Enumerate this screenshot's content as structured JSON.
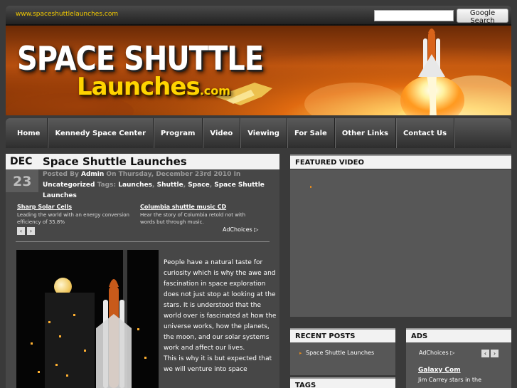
{
  "topbar": {
    "site_url": "www.spaceshuttlelaunches.com",
    "search_button": "Google Search"
  },
  "logo": {
    "line1": "SPACE SHUTTLE",
    "line2": "Launches",
    "dotcom": ".com"
  },
  "nav": {
    "items": [
      "Home",
      "Kennedy Space Center",
      "Program",
      "Video",
      "Viewing",
      "For Sale",
      "Other Links",
      "Contact Us"
    ]
  },
  "post": {
    "month": "DEC",
    "day": "23",
    "title": "Space Shuttle Launches",
    "posted_by_label": "Posted By",
    "author": "Admin",
    "date_text": "On Thursday, December 23rd 2010",
    "in_label": "In",
    "category": "Uncategorized",
    "tags_label": "Tags:",
    "tags": [
      "Launches",
      "Shuttle",
      "Space",
      "Space Shuttle Launches"
    ],
    "body": "People have a natural taste for curiosity which is why the awe and fascination in space exploration does not just stop at looking at the stars. It is understood that the world over is fascinated at how the universe works, how the planets, the moon, and our solar systems work and affect our lives.",
    "body2": "This is why it is but expected that we will venture into space"
  },
  "ads_top": {
    "ad1_title": "Sharp Solar Cells",
    "ad1_desc": "Leading the world with an energy conversion efficiency of 35.8%",
    "ad2_title": "Columbia shuttle music CD",
    "ad2_desc": "Hear the story of Columbia retold not with words but through music.",
    "prev": "‹",
    "next": "›",
    "adchoices": "AdChoices ▷"
  },
  "sidebar": {
    "featured_video_title": "FEATURED VIDEO",
    "recent_posts_title": "RECENT POSTS",
    "recent_posts": [
      "Space Shuttle Launches"
    ],
    "ads_title": "ADS",
    "ads_adchoices": "AdChoices ▷",
    "ads_prev": "‹",
    "ads_next": "›",
    "ads_link": "Galaxy Com",
    "ads_desc": "Jim Carrey stars in the",
    "tags_title": "TAGS"
  },
  "colors": {
    "accent_yellow": "#ffd400",
    "bullet_orange": "#e08a20",
    "panel_gray": "#575757"
  }
}
